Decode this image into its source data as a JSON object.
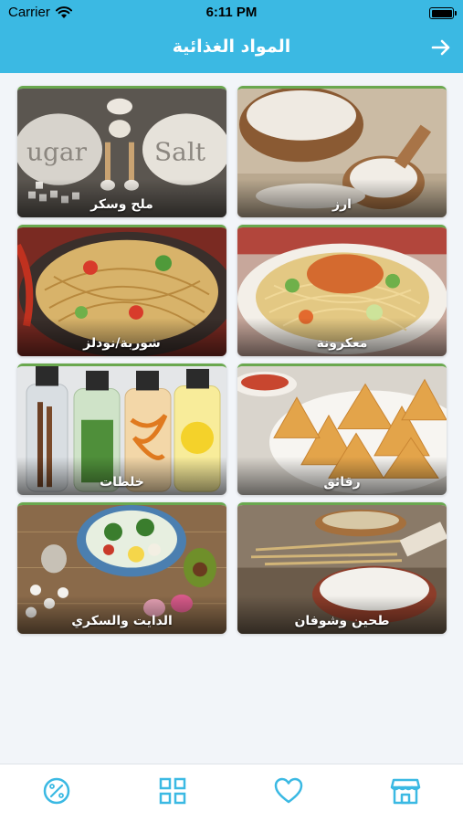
{
  "status_bar": {
    "carrier": "Carrier",
    "time": "6:11 PM"
  },
  "nav": {
    "title": "المواد الغذائية",
    "back_icon": "arrow-right-icon"
  },
  "categories": [
    {
      "label": "ارز"
    },
    {
      "label": "ملح وسكر"
    },
    {
      "label": "معكرونة"
    },
    {
      "label": "شوربة/نودلز"
    },
    {
      "label": "رقائق"
    },
    {
      "label": "خلطات"
    },
    {
      "label": "طحين وشوفان"
    },
    {
      "label": "الدايت والسكري"
    }
  ],
  "tabbar": {
    "items": [
      {
        "icon": "percent-icon"
      },
      {
        "icon": "grid-icon"
      },
      {
        "icon": "heart-icon"
      },
      {
        "icon": "store-icon"
      }
    ]
  },
  "colors": {
    "accent": "#3bb9e3",
    "tile_border": "#6aa84f"
  }
}
